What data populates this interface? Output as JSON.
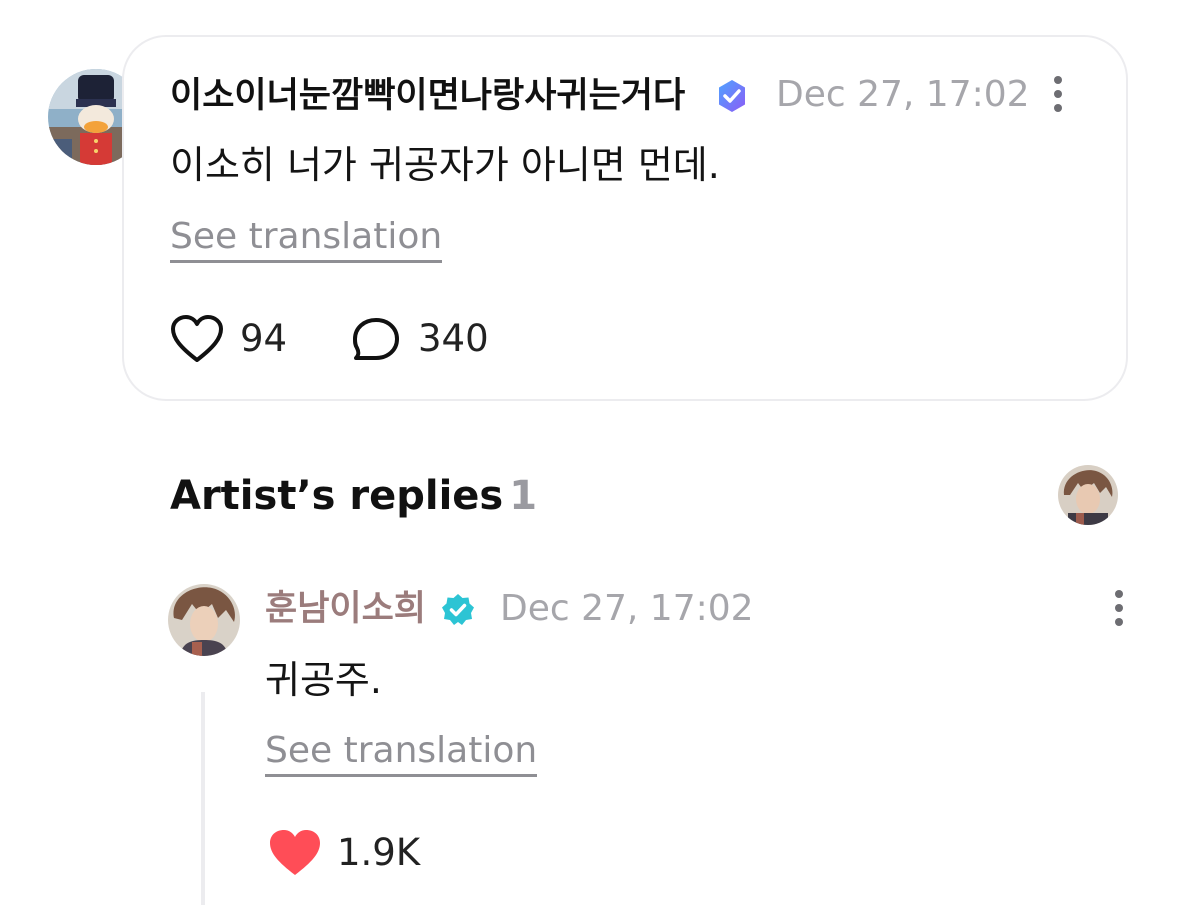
{
  "comment": {
    "author": "이소이너눈깜빡이면나랑사귀는거다",
    "timestamp": "Dec 27, 17:02",
    "text": "이소히 너가 귀공자가 아니면 먼데.",
    "see_translation": "See translation",
    "likes": "94",
    "replies": "340",
    "author_badge_color": "#6c63ff",
    "icons": [
      "heart-outline-icon",
      "speech-bubble-icon",
      "more-vertical-icon",
      "verified-badge-icon"
    ]
  },
  "artist_replies": {
    "title": "Artist’s replies",
    "count": "1"
  },
  "reply": {
    "author": "훈남이소희",
    "timestamp": "Dec 27, 17:02",
    "text": "귀공주.",
    "see_translation": "See translation",
    "likes": "1.9K",
    "author_name_color": "#9b7c7c",
    "badge_color": "#2cc4d4",
    "heart_color": "#ff4d57",
    "icons": [
      "heart-filled-icon",
      "more-vertical-icon",
      "verified-badge-icon"
    ]
  }
}
